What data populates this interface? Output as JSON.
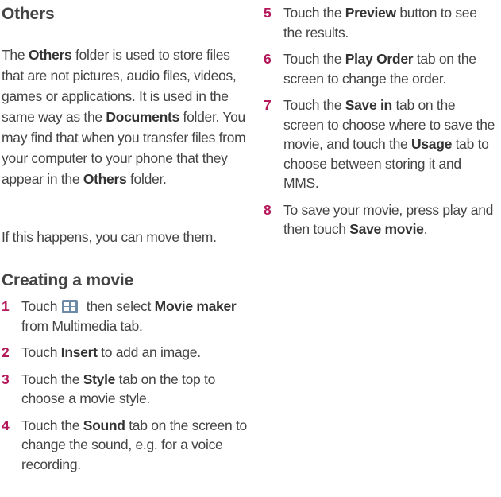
{
  "others": {
    "title": "Others",
    "para1": [
      "The ",
      "Others",
      " folder is used to store files that are not pictures, audio files, videos, games or applications. It is used in the same way as the ",
      "Documents",
      " folder. You may find that when you transfer files from your computer to your phone that they appear in the ",
      "Others",
      " folder."
    ],
    "para2": "If this happens, you can move them."
  },
  "movie": {
    "title": "Creating a movie",
    "steps": [
      {
        "num": "1",
        "parts": [
          "Touch",
          " then select ",
          "Movie maker",
          " from Multimedia tab."
        ],
        "icon": "apps-grid-icon"
      },
      {
        "num": "2",
        "parts": [
          "Touch ",
          "Insert",
          " to add an image."
        ]
      },
      {
        "num": "3",
        "parts": [
          "Touch the ",
          "Style",
          " tab on the top to choose a movie style."
        ]
      },
      {
        "num": "4",
        "parts": [
          "Touch the ",
          "Sound",
          " tab on the screen to change the sound, e.g. for a voice recording."
        ]
      },
      {
        "num": "5",
        "parts": [
          "Touch the ",
          "Preview",
          " button to see the results."
        ]
      },
      {
        "num": "6",
        "parts": [
          "Touch the ",
          "Play Order",
          " tab on the screen to change the order."
        ]
      },
      {
        "num": "7",
        "parts": [
          "Touch the ",
          "Save in",
          " tab on the screen to choose where to save the movie, and touch the ",
          "Usage",
          " tab to choose between storing it and MMS."
        ]
      },
      {
        "num": "8",
        "parts": [
          "To save your movie, press play and then touch ",
          "Save movie",
          "."
        ]
      }
    ]
  },
  "colors": {
    "step_number": "#b5185a",
    "text": "#444444"
  }
}
